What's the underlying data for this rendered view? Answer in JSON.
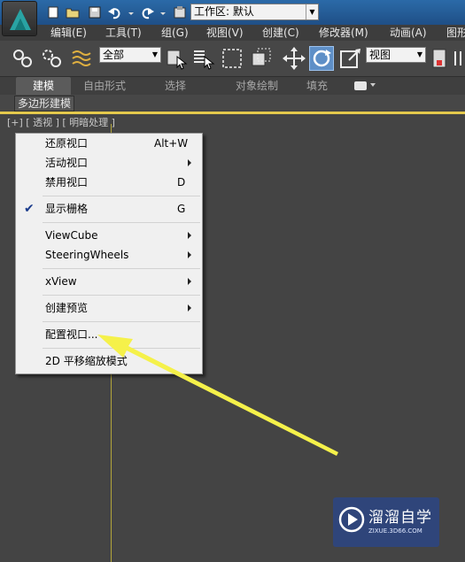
{
  "quick_access": {
    "workspace_label": "工作区: 默认"
  },
  "menubar": {
    "items": [
      "编辑(E)",
      "工具(T)",
      "组(G)",
      "视图(V)",
      "创建(C)",
      "修改器(M)",
      "动画(A)",
      "图形"
    ]
  },
  "toolbar": {
    "selection_filter": "全部",
    "reference_coord": "视图"
  },
  "ribbon": {
    "tabs": [
      "建模",
      "自由形式",
      "选择",
      "对象绘制",
      "填充"
    ],
    "active_tab": "建模",
    "panel_label": "多边形建模"
  },
  "viewport": {
    "label": "[+] [ 透视 ] [ 明暗处理 ]"
  },
  "context_menu": {
    "items": [
      {
        "label": "还原视口",
        "shortcut": "Alt+W"
      },
      {
        "label": "活动视口",
        "submenu": true
      },
      {
        "label": "禁用视口",
        "shortcut": "D"
      },
      {
        "label": "显示栅格",
        "shortcut": "G",
        "checked": true
      },
      {
        "label": "ViewCube",
        "submenu": true
      },
      {
        "label": "SteeringWheels",
        "submenu": true
      },
      {
        "label": "xView",
        "submenu": true
      },
      {
        "label": "创建预览",
        "submenu": true
      },
      {
        "label": "配置视口..."
      },
      {
        "label": "2D 平移缩放模式"
      }
    ]
  },
  "annotation": {
    "arrow_color": "#f5f14a"
  },
  "watermark": {
    "name": "溜溜自学",
    "url": "ZIXUE.3D66.COM"
  },
  "colors": {
    "viewport_bg": "#444444",
    "ribbon_accent": "#e4c94c",
    "title_blue": "#2b6aa8"
  }
}
